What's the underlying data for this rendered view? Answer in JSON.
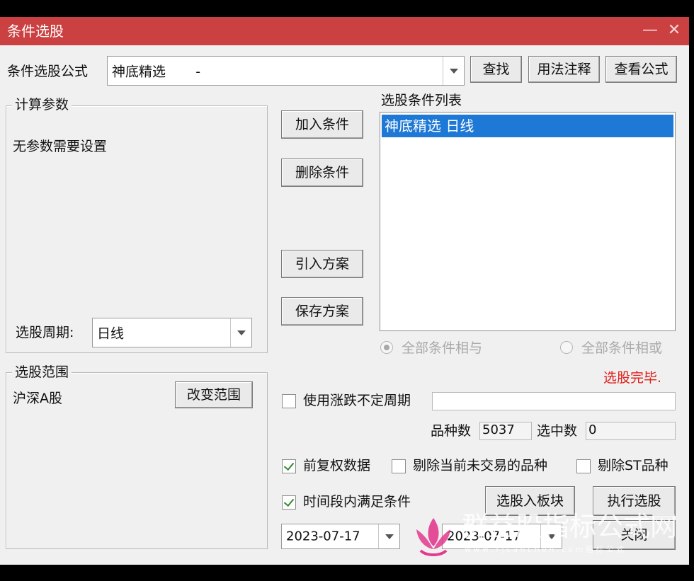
{
  "window": {
    "title": "条件选股",
    "minimize_glyph": "—",
    "close_glyph": "✕"
  },
  "formula": {
    "label": "条件选股公式",
    "value": "神底精选       -",
    "find_label": "查找",
    "usage_label": "用法注释",
    "view_label": "查看公式"
  },
  "params": {
    "group_title": "计算参数",
    "no_params_text": "无参数需要设置",
    "period_label": "选股周期:",
    "period_value": "日线"
  },
  "scope": {
    "group_title": "选股范围",
    "value": "沪深A股",
    "change_label": "改变范围"
  },
  "middle_buttons": {
    "add_label": "加入条件",
    "delete_label": "删除条件",
    "import_label": "引入方案",
    "save_label": "保存方案"
  },
  "conditions": {
    "list_title": "选股条件列表",
    "items": [
      "神底精选  日线"
    ],
    "selected_index": 0,
    "radio_and_label": "全部条件相与",
    "radio_or_label": "全部条件相或",
    "radio_selected": "and"
  },
  "status": {
    "text": "选股完毕.",
    "color": "#e0201c"
  },
  "options": {
    "variable_period_label": "使用涨跌不定周期",
    "variable_period_checked": false,
    "variable_period_value": "",
    "count_label": "品种数",
    "count_value": "5037",
    "selected_label": "选中数",
    "selected_value": "0",
    "forward_adjust_label": "前复权数据",
    "forward_adjust_checked": true,
    "exclude_untraded_label": "剔除当前未交易的品种",
    "exclude_untraded_checked": false,
    "exclude_st_label": "剔除ST品种",
    "exclude_st_checked": false,
    "time_range_label": "时间段内满足条件",
    "time_range_checked": true
  },
  "actions": {
    "to_block_label": "选股入板块",
    "execute_label": "执行选股",
    "close_label": "关闭"
  },
  "dates": {
    "start": "2023-07-17",
    "end": "2023-07-17"
  },
  "watermark": {
    "text": "群益股指标公式网",
    "url": "w w w . r j s a n c h e n . c o m   指 标 公 式"
  },
  "colors": {
    "title_bar": "#cb4040",
    "selection": "#1e78d6",
    "window_bg": "#f0f0f0"
  }
}
